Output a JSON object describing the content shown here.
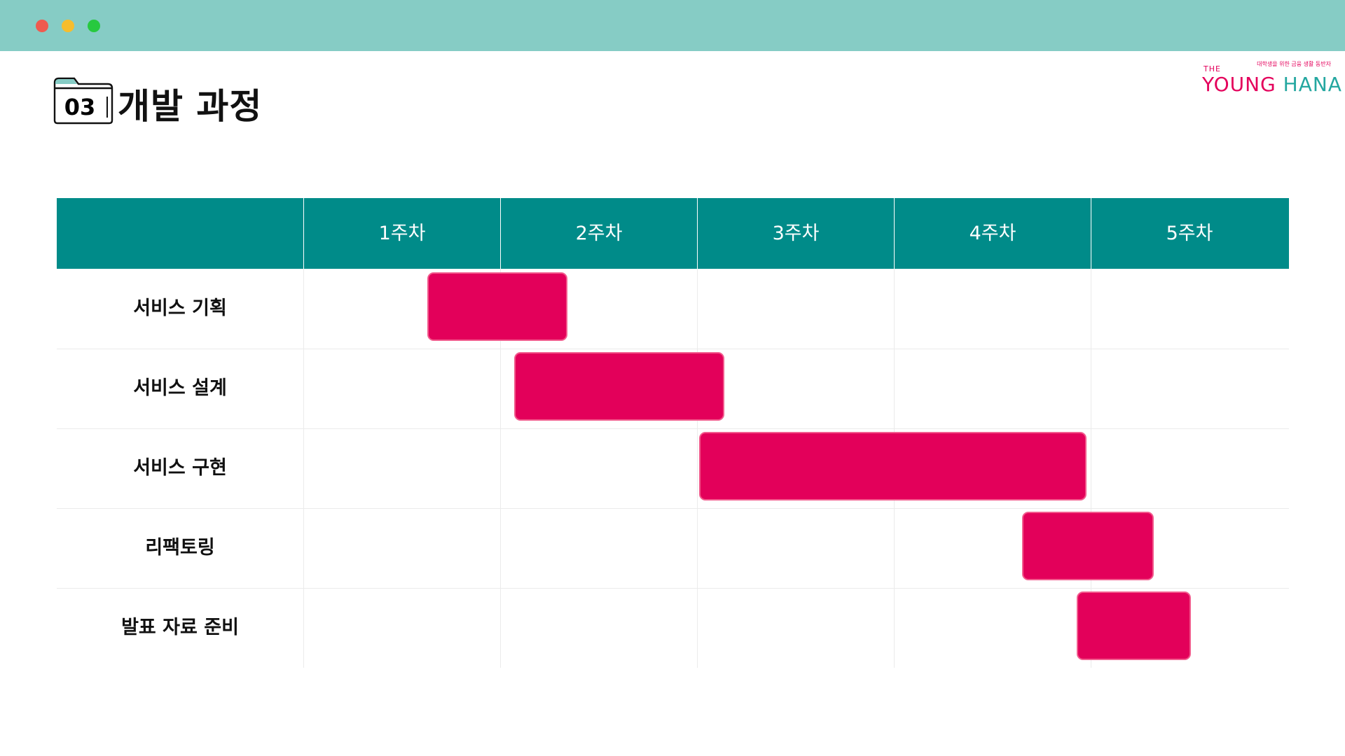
{
  "window": {
    "controls": [
      "close",
      "minimize",
      "maximize"
    ],
    "titlebar_color": "#86ccc5"
  },
  "header": {
    "section_number": "03",
    "title": "개발 과정"
  },
  "logo": {
    "prefix": "THE",
    "tagline": "대학생을 위한 금융 생활 동반자",
    "part1": "YOUNG",
    "part2": "HANA"
  },
  "chart_data": {
    "type": "gantt",
    "columns": [
      "1주차",
      "2주차",
      "3주차",
      "4주차",
      "5주차"
    ],
    "tasks": [
      {
        "label": "서비스 기획",
        "start": 0.63,
        "end": 1.34
      },
      {
        "label": "서비스 설계",
        "start": 1.07,
        "end": 2.14
      },
      {
        "label": "서비스 구현",
        "start": 2.01,
        "end": 3.98
      },
      {
        "label": "리팩토링",
        "start": 3.65,
        "end": 4.32
      },
      {
        "label": "발표 자료 준비",
        "start": 3.93,
        "end": 4.51
      }
    ],
    "header_color": "#008b89",
    "bar_color": "#e3005a"
  }
}
